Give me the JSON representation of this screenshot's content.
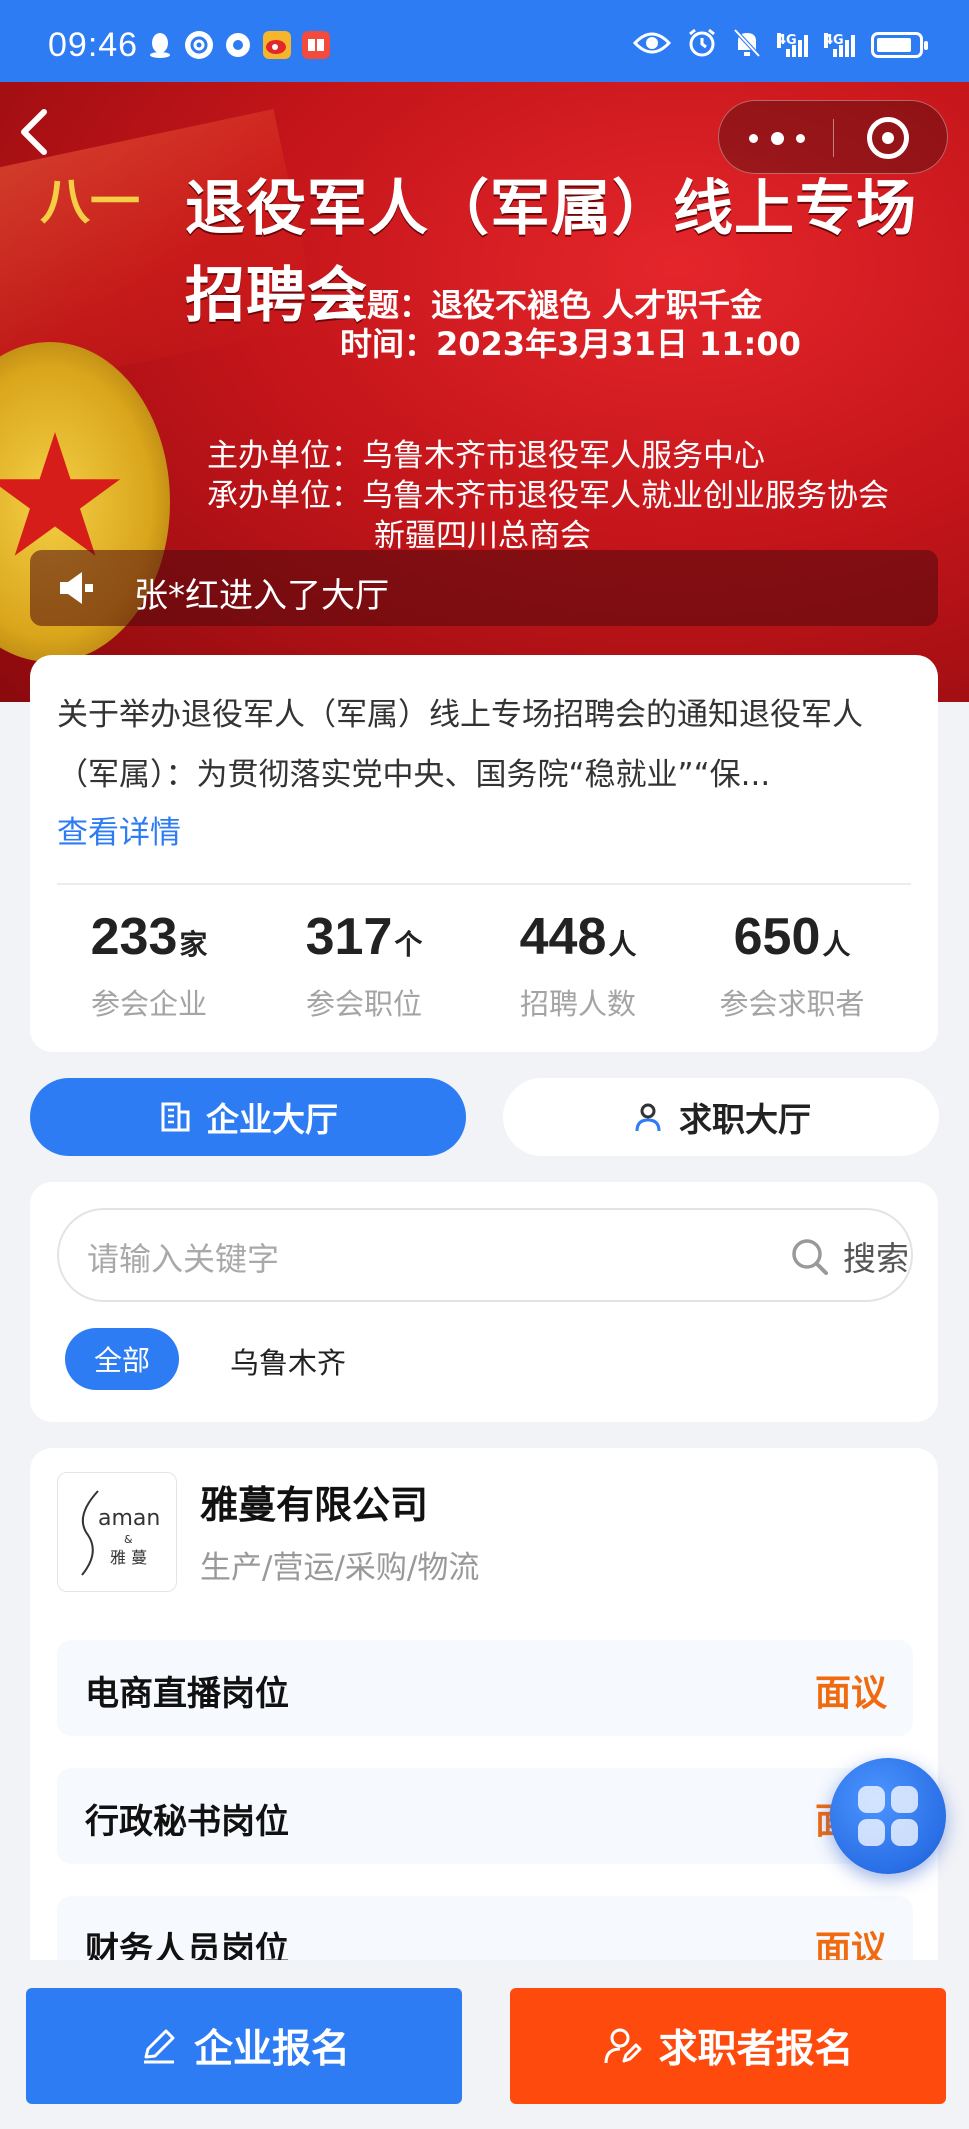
{
  "status_bar": {
    "time": "09:46",
    "left_icons": [
      "qq-icon",
      "app-icon",
      "chrome-icon",
      "weibo-icon",
      "book-icon"
    ],
    "right_icons": [
      "eye-icon",
      "alarm-icon",
      "mute-icon",
      "signal-icon",
      "signal-icon",
      "battery-icon"
    ],
    "network_label_1": "4G",
    "network_label_2": "4G",
    "battery_level": 0.85,
    "color": "#2d7cf3"
  },
  "banner": {
    "bayi": "八一",
    "title": "退役军人（军属）线上专场招聘会",
    "theme": "主题：退役不褪色 人才职千金",
    "time": "时间：2023年3月31日 11:00",
    "organizer": "主办单位：乌鲁木齐市退役军人服务中心",
    "co_organizer": "承办单位：乌鲁木齐市退役军人就业创业服务协会",
    "co_organizer_2": "新疆四川总商会",
    "notice": "张*红进入了大厅"
  },
  "intro": {
    "text": "关于举办退役军人（军属）线上专场招聘会的通知退役军人（军属）：为贯彻落实党中央、国务院“稳就业”“保...",
    "detail_link": "查看详情"
  },
  "stats": [
    {
      "value": "233",
      "unit": "家",
      "label": "参会企业"
    },
    {
      "value": "317",
      "unit": "个",
      "label": "参会职位"
    },
    {
      "value": "448",
      "unit": "人",
      "label": "招聘人数"
    },
    {
      "value": "650",
      "unit": "人",
      "label": "参会求职者"
    }
  ],
  "tabs": {
    "company_hall": "企业大厅",
    "jobseeker_hall": "求职大厅"
  },
  "search": {
    "placeholder": "请输入关键字",
    "button": "搜索",
    "filters": [
      "全部",
      "乌鲁木齐"
    ]
  },
  "company": {
    "logo_text_1": "aman",
    "logo_text_2": "&",
    "logo_text_3": "雅 蔓",
    "name": "雅蔓有限公司",
    "category": "生产/营运/采购/物流",
    "jobs": [
      {
        "title": "电商直播岗位",
        "salary": "面议"
      },
      {
        "title": "行政秘书岗位",
        "salary": "面议"
      },
      {
        "title": "财务人员岗位",
        "salary": "面议"
      }
    ]
  },
  "bottom": {
    "company_signup": "企业报名",
    "seeker_signup": "求职者报名"
  },
  "colors": {
    "primary": "#2d7cf3",
    "orange": "#fe4a0d",
    "salary": "#f06a0f"
  }
}
